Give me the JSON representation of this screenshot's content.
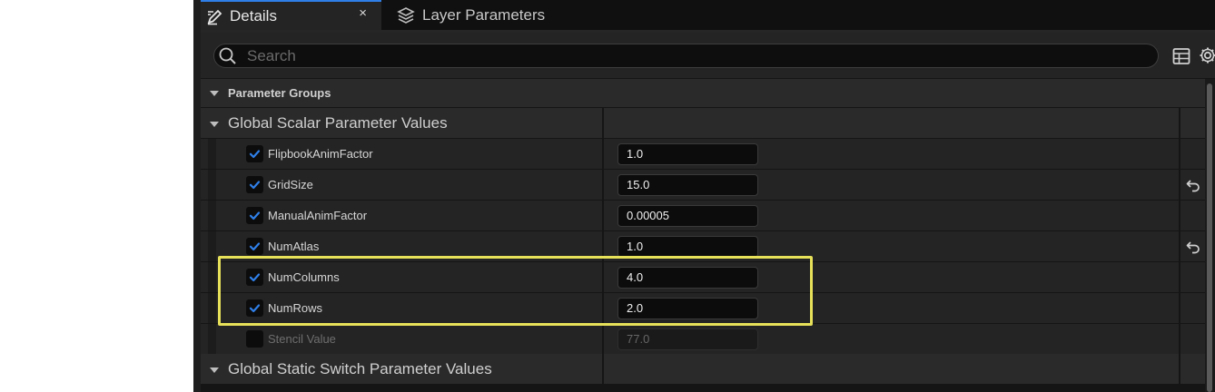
{
  "tabs": {
    "details": {
      "label": "Details",
      "close": "×"
    },
    "layer_parameters": {
      "label": "Layer Parameters"
    }
  },
  "search": {
    "placeholder": "Search",
    "value": ""
  },
  "groups": {
    "parameter_groups": "Parameter Groups",
    "scalar": "Global Scalar Parameter Values",
    "static_switch": "Global Static Switch Parameter Values"
  },
  "params": [
    {
      "name": "FlipbookAnimFactor",
      "value": "1.0",
      "checked": true,
      "reset": false
    },
    {
      "name": "GridSize",
      "value": "15.0",
      "checked": true,
      "reset": true
    },
    {
      "name": "ManualAnimFactor",
      "value": "0.00005",
      "checked": true,
      "reset": false
    },
    {
      "name": "NumAtlas",
      "value": "1.0",
      "checked": true,
      "reset": true
    },
    {
      "name": "NumColumns",
      "value": "4.0",
      "checked": true,
      "reset": false
    },
    {
      "name": "NumRows",
      "value": "2.0",
      "checked": true,
      "reset": false
    },
    {
      "name": "Stencil Value",
      "value": "77.0",
      "checked": false,
      "reset": false
    }
  ],
  "colors": {
    "accent_blue": "#2f7fe8",
    "highlight_yellow": "#e7e15a",
    "panel_bg": "#151515",
    "row_bg": "#242424"
  },
  "icons": {
    "details_tab": "pencil-icon",
    "layers_tab": "layers-icon",
    "search": "search-icon",
    "table_view": "table-icon",
    "settings": "gear-icon",
    "reset": "reset-arrow-icon"
  }
}
